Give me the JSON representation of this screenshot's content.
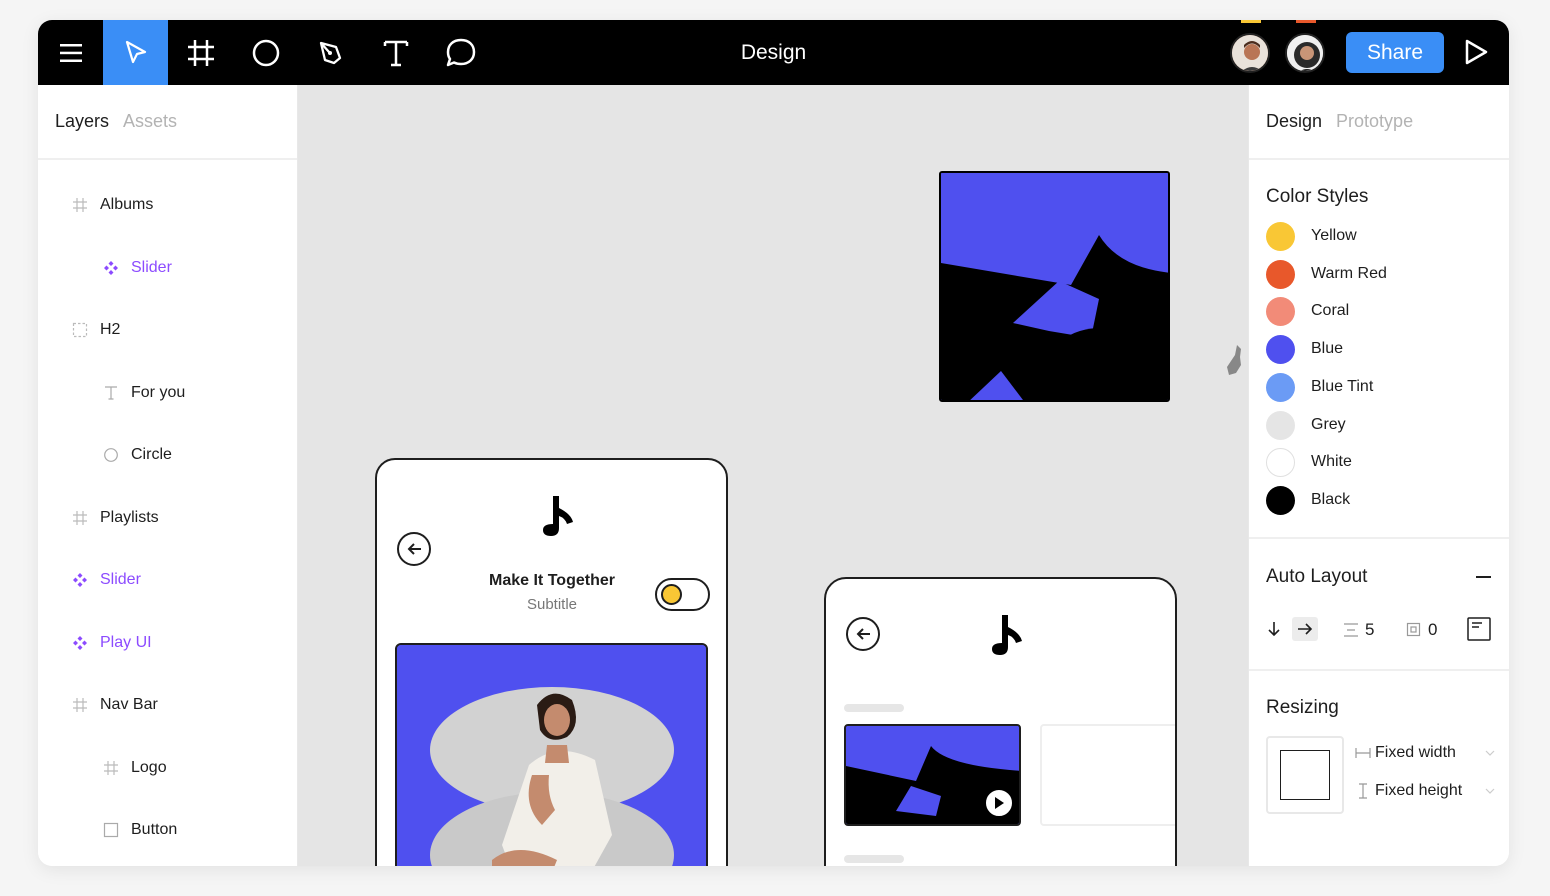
{
  "toolbar": {
    "title": "Design",
    "share_label": "Share",
    "tools": [
      "menu-icon",
      "move-icon",
      "frame-icon",
      "ellipse-icon",
      "pen-icon",
      "text-icon",
      "comment-icon"
    ],
    "accent": "#3a8ef6"
  },
  "left_panel": {
    "tabs": {
      "active": "Layers",
      "inactive": "Assets"
    },
    "layers": [
      {
        "label": "Albums",
        "icon": "frame-icon",
        "indent": 0,
        "component": false
      },
      {
        "label": "Slider",
        "icon": "component-icon",
        "indent": 1,
        "component": true
      },
      {
        "label": "H2",
        "icon": "group-icon",
        "indent": 0,
        "component": false
      },
      {
        "label": "For you",
        "icon": "text-icon",
        "indent": 1,
        "component": false
      },
      {
        "label": "Circle",
        "icon": "ellipse-icon",
        "indent": 1,
        "component": false
      },
      {
        "label": "Playlists",
        "icon": "frame-icon",
        "indent": 0,
        "component": false
      },
      {
        "label": "Slider",
        "icon": "component-icon",
        "indent": 0,
        "component": true
      },
      {
        "label": "Play UI",
        "icon": "component-icon",
        "indent": 0,
        "component": true
      },
      {
        "label": "Nav Bar",
        "icon": "frame-icon",
        "indent": 0,
        "component": false
      },
      {
        "label": "Logo",
        "icon": "frame-icon",
        "indent": 1,
        "component": false
      },
      {
        "label": "Button",
        "icon": "rectangle-icon",
        "indent": 1,
        "component": false
      }
    ]
  },
  "canvas": {
    "card1": {
      "title": "Make It Together",
      "subtitle": "Subtitle"
    }
  },
  "right_panel": {
    "tabs": {
      "active": "Design",
      "inactive": "Prototype"
    },
    "color_styles": {
      "title": "Color Styles",
      "items": [
        {
          "name": "Yellow",
          "color": "#f9c735"
        },
        {
          "name": "Warm Red",
          "color": "#e8582b"
        },
        {
          "name": "Coral",
          "color": "#f28b78"
        },
        {
          "name": "Blue",
          "color": "#4f50ef"
        },
        {
          "name": "Blue Tint",
          "color": "#6b9bf5"
        },
        {
          "name": "Grey",
          "color": "#e5e5e5"
        },
        {
          "name": "White",
          "color": "#ffffff"
        },
        {
          "name": "Black",
          "color": "#000000"
        }
      ]
    },
    "auto_layout": {
      "title": "Auto Layout",
      "spacing": "5",
      "padding": "0"
    },
    "resizing": {
      "title": "Resizing",
      "width_label": "Fixed width",
      "height_label": "Fixed height"
    }
  }
}
